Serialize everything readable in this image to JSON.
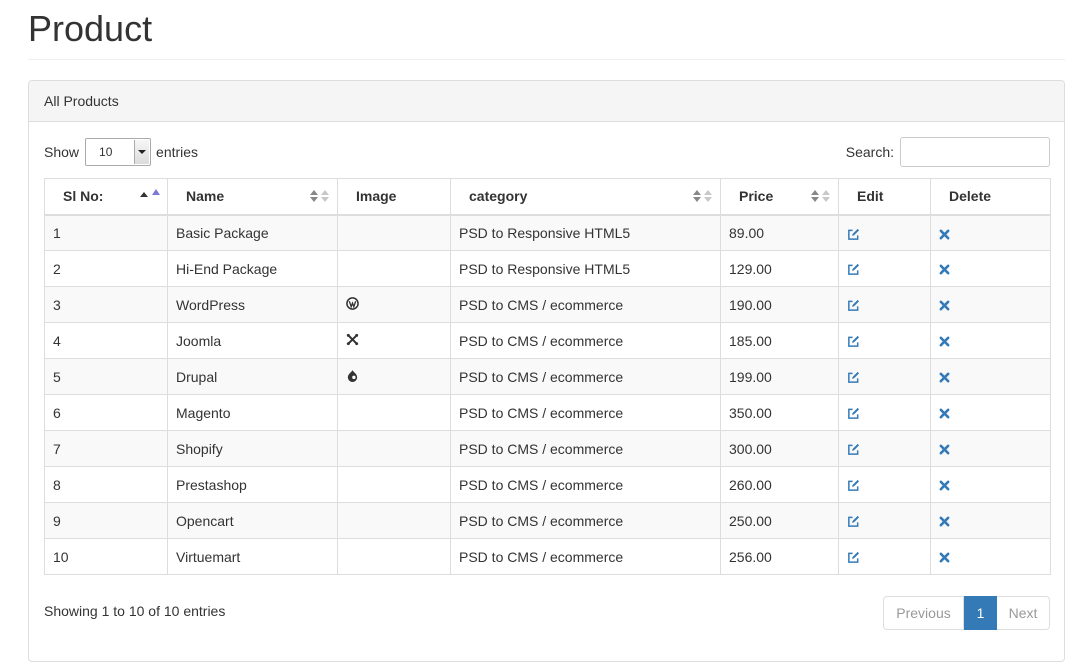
{
  "page": {
    "title": "Product"
  },
  "panel": {
    "heading": "All Products"
  },
  "length": {
    "show_label": "Show",
    "value": "10",
    "entries_label": "entries"
  },
  "search": {
    "label": "Search:",
    "value": ""
  },
  "table": {
    "columns": [
      "Sl No:",
      "Name",
      "Image",
      "category",
      "Price",
      "Edit",
      "Delete"
    ],
    "sorted_column": "Sl No:",
    "rows": [
      {
        "no": "1",
        "name": "Basic Package",
        "image": "",
        "category": "PSD to Responsive HTML5",
        "price": "89.00"
      },
      {
        "no": "2",
        "name": "Hi-End Package",
        "image": "",
        "category": "PSD to Responsive HTML5",
        "price": "129.00"
      },
      {
        "no": "3",
        "name": "WordPress",
        "image": "wordpress-icon",
        "category": "PSD to CMS / ecommerce",
        "price": "190.00"
      },
      {
        "no": "4",
        "name": "Joomla",
        "image": "joomla-icon",
        "category": "PSD to CMS / ecommerce",
        "price": "185.00"
      },
      {
        "no": "5",
        "name": "Drupal",
        "image": "drupal-icon",
        "category": "PSD to CMS / ecommerce",
        "price": "199.00"
      },
      {
        "no": "6",
        "name": "Magento",
        "image": "",
        "category": "PSD to CMS / ecommerce",
        "price": "350.00"
      },
      {
        "no": "7",
        "name": "Shopify",
        "image": "",
        "category": "PSD to CMS / ecommerce",
        "price": "300.00"
      },
      {
        "no": "8",
        "name": "Prestashop",
        "image": "",
        "category": "PSD to CMS / ecommerce",
        "price": "260.00"
      },
      {
        "no": "9",
        "name": "Opencart",
        "image": "",
        "category": "PSD to CMS / ecommerce",
        "price": "250.00"
      },
      {
        "no": "10",
        "name": "Virtuemart",
        "image": "",
        "category": "PSD to CMS / ecommerce",
        "price": "256.00"
      }
    ],
    "edit_icon": "edit-icon",
    "delete_icon": "delete-icon"
  },
  "footer": {
    "info": "Showing 1 to 10 of 10 entries",
    "previous": "Previous",
    "current_page": "1",
    "next": "Next"
  },
  "colors": {
    "accent": "#337ab7",
    "icon_blue": "#337ab7",
    "row_stripe": "#f9f9f9",
    "panel_heading_bg": "#f5f5f5"
  }
}
